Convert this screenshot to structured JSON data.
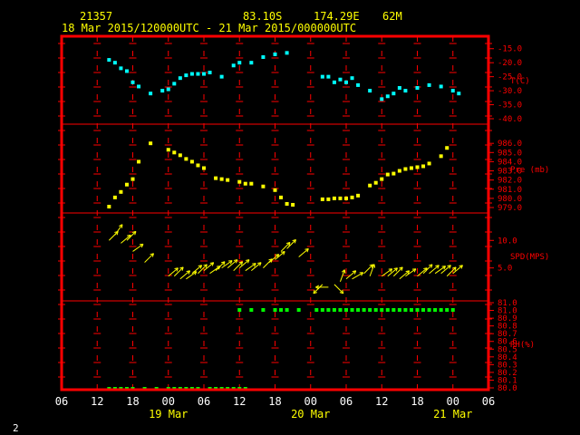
{
  "header": {
    "station": "21357",
    "lat": "83.10S",
    "lon": "174.29E",
    "elev": "62M",
    "period": "18 Mar 2015/120000UTC - 21 Mar 2015/000000UTC"
  },
  "footer": {
    "page": "2"
  },
  "colors": {
    "frame": "#ff0000",
    "temp": "#00ffff",
    "pressure": "#ffff00",
    "wind": "#ffff00",
    "rh": "#00ff00",
    "text": "#ffffff"
  },
  "chart_data": {
    "type": "scatter",
    "x_unit": "hour from 18 Mar 2015 00 UTC",
    "x_range": [
      6,
      78
    ],
    "x_tick_labels": [
      "06",
      "12",
      "18",
      "00",
      "06",
      "12",
      "18",
      "00",
      "06",
      "12",
      "18",
      "00",
      "06"
    ],
    "x_date_labels": [
      "19 Mar",
      "20 Mar",
      "21 Mar"
    ],
    "panels": [
      {
        "name": "temperature",
        "label": "T(C)",
        "ylim": [
          -40,
          -12.5
        ],
        "ticks": [
          "-15.0",
          "-20.0",
          "-25.0",
          "-30.0",
          "-35.0",
          "-40.0"
        ],
        "tick_values": [
          -15,
          -20,
          -25,
          -30,
          -35,
          -40
        ],
        "points": [
          [
            14,
            -19
          ],
          [
            15,
            -20
          ],
          [
            16,
            -22
          ],
          [
            17,
            -23
          ],
          [
            18,
            -27
          ],
          [
            19,
            -28.5
          ],
          [
            21,
            -31
          ],
          [
            23,
            -30
          ],
          [
            24,
            -29.5
          ],
          [
            25,
            -27.5
          ],
          [
            26,
            -25.5
          ],
          [
            27,
            -24.5
          ],
          [
            28,
            -24
          ],
          [
            29,
            -24
          ],
          [
            30,
            -24
          ],
          [
            31,
            -23.5
          ],
          [
            33,
            -25
          ],
          [
            35,
            -21
          ],
          [
            36,
            -20
          ],
          [
            38,
            -20
          ],
          [
            40,
            -18
          ],
          [
            42,
            -17
          ],
          [
            44,
            -16.5
          ],
          [
            50,
            -25
          ],
          [
            51,
            -25
          ],
          [
            52,
            -27
          ],
          [
            53,
            -26
          ],
          [
            54,
            -27
          ],
          [
            55,
            -25.5
          ],
          [
            56,
            -28
          ],
          [
            58,
            -30
          ],
          [
            60,
            -33
          ],
          [
            61,
            -32
          ],
          [
            62,
            -31
          ],
          [
            63,
            -29
          ],
          [
            64,
            -30
          ],
          [
            66,
            -29
          ],
          [
            68,
            -28
          ],
          [
            70,
            -28.5
          ],
          [
            72,
            -30
          ],
          [
            73,
            -31
          ]
        ]
      },
      {
        "name": "pressure",
        "label": "Pre (mb)",
        "ylim": [
          979,
          987.5
        ],
        "ticks": [
          "986.0",
          "985.0",
          "984.0",
          "983.0",
          "982.0",
          "981.0",
          "980.0",
          "979.0"
        ],
        "tick_values": [
          986,
          985,
          984,
          983,
          982,
          981,
          980,
          979
        ],
        "points": [
          [
            14,
            979.1
          ],
          [
            15,
            980.1
          ],
          [
            16,
            980.7
          ],
          [
            17,
            981.5
          ],
          [
            18,
            982.1
          ],
          [
            19,
            984.0
          ],
          [
            21,
            986.0
          ],
          [
            24,
            985.3
          ],
          [
            25,
            985.0
          ],
          [
            26,
            984.7
          ],
          [
            27,
            984.3
          ],
          [
            28,
            984.0
          ],
          [
            29,
            983.6
          ],
          [
            30,
            983.3
          ],
          [
            32,
            982.2
          ],
          [
            33,
            982.1
          ],
          [
            34,
            982.0
          ],
          [
            36,
            981.8
          ],
          [
            37,
            981.6
          ],
          [
            38,
            981.6
          ],
          [
            40,
            981.3
          ],
          [
            42,
            980.9
          ],
          [
            43,
            980.1
          ],
          [
            44,
            979.4
          ],
          [
            45,
            979.3
          ],
          [
            50,
            979.9
          ],
          [
            51,
            979.9
          ],
          [
            52,
            980.0
          ],
          [
            53,
            980.0
          ],
          [
            54,
            980.0
          ],
          [
            55,
            980.1
          ],
          [
            56,
            980.3
          ],
          [
            58,
            981.4
          ],
          [
            59,
            981.7
          ],
          [
            60,
            982.1
          ],
          [
            61,
            982.6
          ],
          [
            62,
            982.7
          ],
          [
            63,
            983.0
          ],
          [
            64,
            983.2
          ],
          [
            65,
            983.3
          ],
          [
            66,
            983.4
          ],
          [
            67,
            983.5
          ],
          [
            68,
            983.8
          ],
          [
            70,
            984.6
          ],
          [
            71,
            985.5
          ]
        ]
      },
      {
        "name": "wind",
        "label": "SPD(MPS)",
        "ticks": [
          "10.0",
          "5.0"
        ],
        "tick_values": [
          10,
          5
        ],
        "points": [
          [
            14,
            10.0,
            225
          ],
          [
            15,
            11.0,
            215
          ],
          [
            16,
            9.5,
            230
          ],
          [
            17,
            10.0,
            225
          ],
          [
            18,
            8.0,
            235
          ],
          [
            20,
            6.0,
            225
          ],
          [
            24,
            3.5,
            230
          ],
          [
            25,
            3.5,
            225
          ],
          [
            26,
            3.0,
            230
          ],
          [
            27,
            3.0,
            235
          ],
          [
            28,
            4.0,
            230
          ],
          [
            29,
            4.0,
            225
          ],
          [
            30,
            4.5,
            230
          ],
          [
            31,
            4.0,
            235
          ],
          [
            32,
            4.5,
            225
          ],
          [
            33,
            5.0,
            235
          ],
          [
            34,
            5.0,
            230
          ],
          [
            35,
            4.5,
            225
          ],
          [
            36,
            5.0,
            230
          ],
          [
            37,
            4.5,
            235
          ],
          [
            38,
            4.5,
            230
          ],
          [
            40,
            5.0,
            225
          ],
          [
            41,
            6.0,
            230
          ],
          [
            42,
            6.5,
            230
          ],
          [
            43,
            8.0,
            225
          ],
          [
            44,
            8.5,
            225
          ],
          [
            46,
            7.0,
            230
          ],
          [
            50,
            2.0,
            45
          ],
          [
            51,
            1.5,
            90
          ],
          [
            52,
            2.0,
            315
          ],
          [
            53,
            2.5,
            200
          ],
          [
            54,
            3.0,
            230
          ],
          [
            55,
            3.0,
            240
          ],
          [
            57,
            4.0,
            225
          ],
          [
            58,
            3.5,
            200
          ],
          [
            60,
            3.5,
            235
          ],
          [
            61,
            3.5,
            230
          ],
          [
            62,
            3.5,
            225
          ],
          [
            63,
            3.0,
            230
          ],
          [
            64,
            3.5,
            235
          ],
          [
            66,
            3.5,
            230
          ],
          [
            67,
            4.0,
            225
          ],
          [
            68,
            4.0,
            230
          ],
          [
            69,
            4.0,
            235
          ],
          [
            70,
            4.0,
            230
          ],
          [
            71,
            3.5,
            225
          ],
          [
            72,
            4.0,
            230
          ]
        ]
      },
      {
        "name": "rh",
        "label": "RH(%)",
        "ylim": [
          80.0,
          81.0
        ],
        "ticks": [
          "81.0",
          "81.0",
          "80.9",
          "80.8",
          "80.7",
          "80.6",
          "80.5",
          "80.4",
          "80.3",
          "80.2",
          "80.1",
          "80.0"
        ],
        "tick_values": [
          81.1,
          81.0,
          80.9,
          80.8,
          80.7,
          80.6,
          80.5,
          80.4,
          80.3,
          80.2,
          80.1,
          80.0
        ],
        "points": [
          [
            14,
            80.0
          ],
          [
            15,
            80.0
          ],
          [
            16,
            80.0
          ],
          [
            17,
            80.0
          ],
          [
            18,
            80.0
          ],
          [
            20,
            80.0
          ],
          [
            22,
            80.0
          ],
          [
            24,
            80.0
          ],
          [
            25,
            80.0
          ],
          [
            26,
            80.0
          ],
          [
            27,
            80.0
          ],
          [
            28,
            80.0
          ],
          [
            29,
            80.0
          ],
          [
            31,
            80.0
          ],
          [
            32,
            80.0
          ],
          [
            33,
            80.0
          ],
          [
            34,
            80.0
          ],
          [
            35,
            80.0
          ],
          [
            36,
            80.0
          ],
          [
            37,
            80.0
          ],
          [
            36,
            81.0
          ],
          [
            38,
            81.0
          ],
          [
            40,
            81.0
          ],
          [
            42,
            81.0
          ],
          [
            43,
            81.0
          ],
          [
            44,
            81.0
          ],
          [
            46,
            81.0
          ],
          [
            49,
            81.0
          ],
          [
            50,
            81.0
          ],
          [
            51,
            81.0
          ],
          [
            52,
            81.0
          ],
          [
            53,
            81.0
          ],
          [
            54,
            81.0
          ],
          [
            55,
            81.0
          ],
          [
            56,
            81.0
          ],
          [
            57,
            81.0
          ],
          [
            58,
            81.0
          ],
          [
            59,
            81.0
          ],
          [
            60,
            81.0
          ],
          [
            61,
            81.0
          ],
          [
            62,
            81.0
          ],
          [
            63,
            81.0
          ],
          [
            64,
            81.0
          ],
          [
            65,
            81.0
          ],
          [
            66,
            81.0
          ],
          [
            67,
            81.0
          ],
          [
            68,
            81.0
          ],
          [
            69,
            81.0
          ],
          [
            70,
            81.0
          ],
          [
            71,
            81.0
          ],
          [
            72,
            81.0
          ]
        ]
      }
    ]
  }
}
